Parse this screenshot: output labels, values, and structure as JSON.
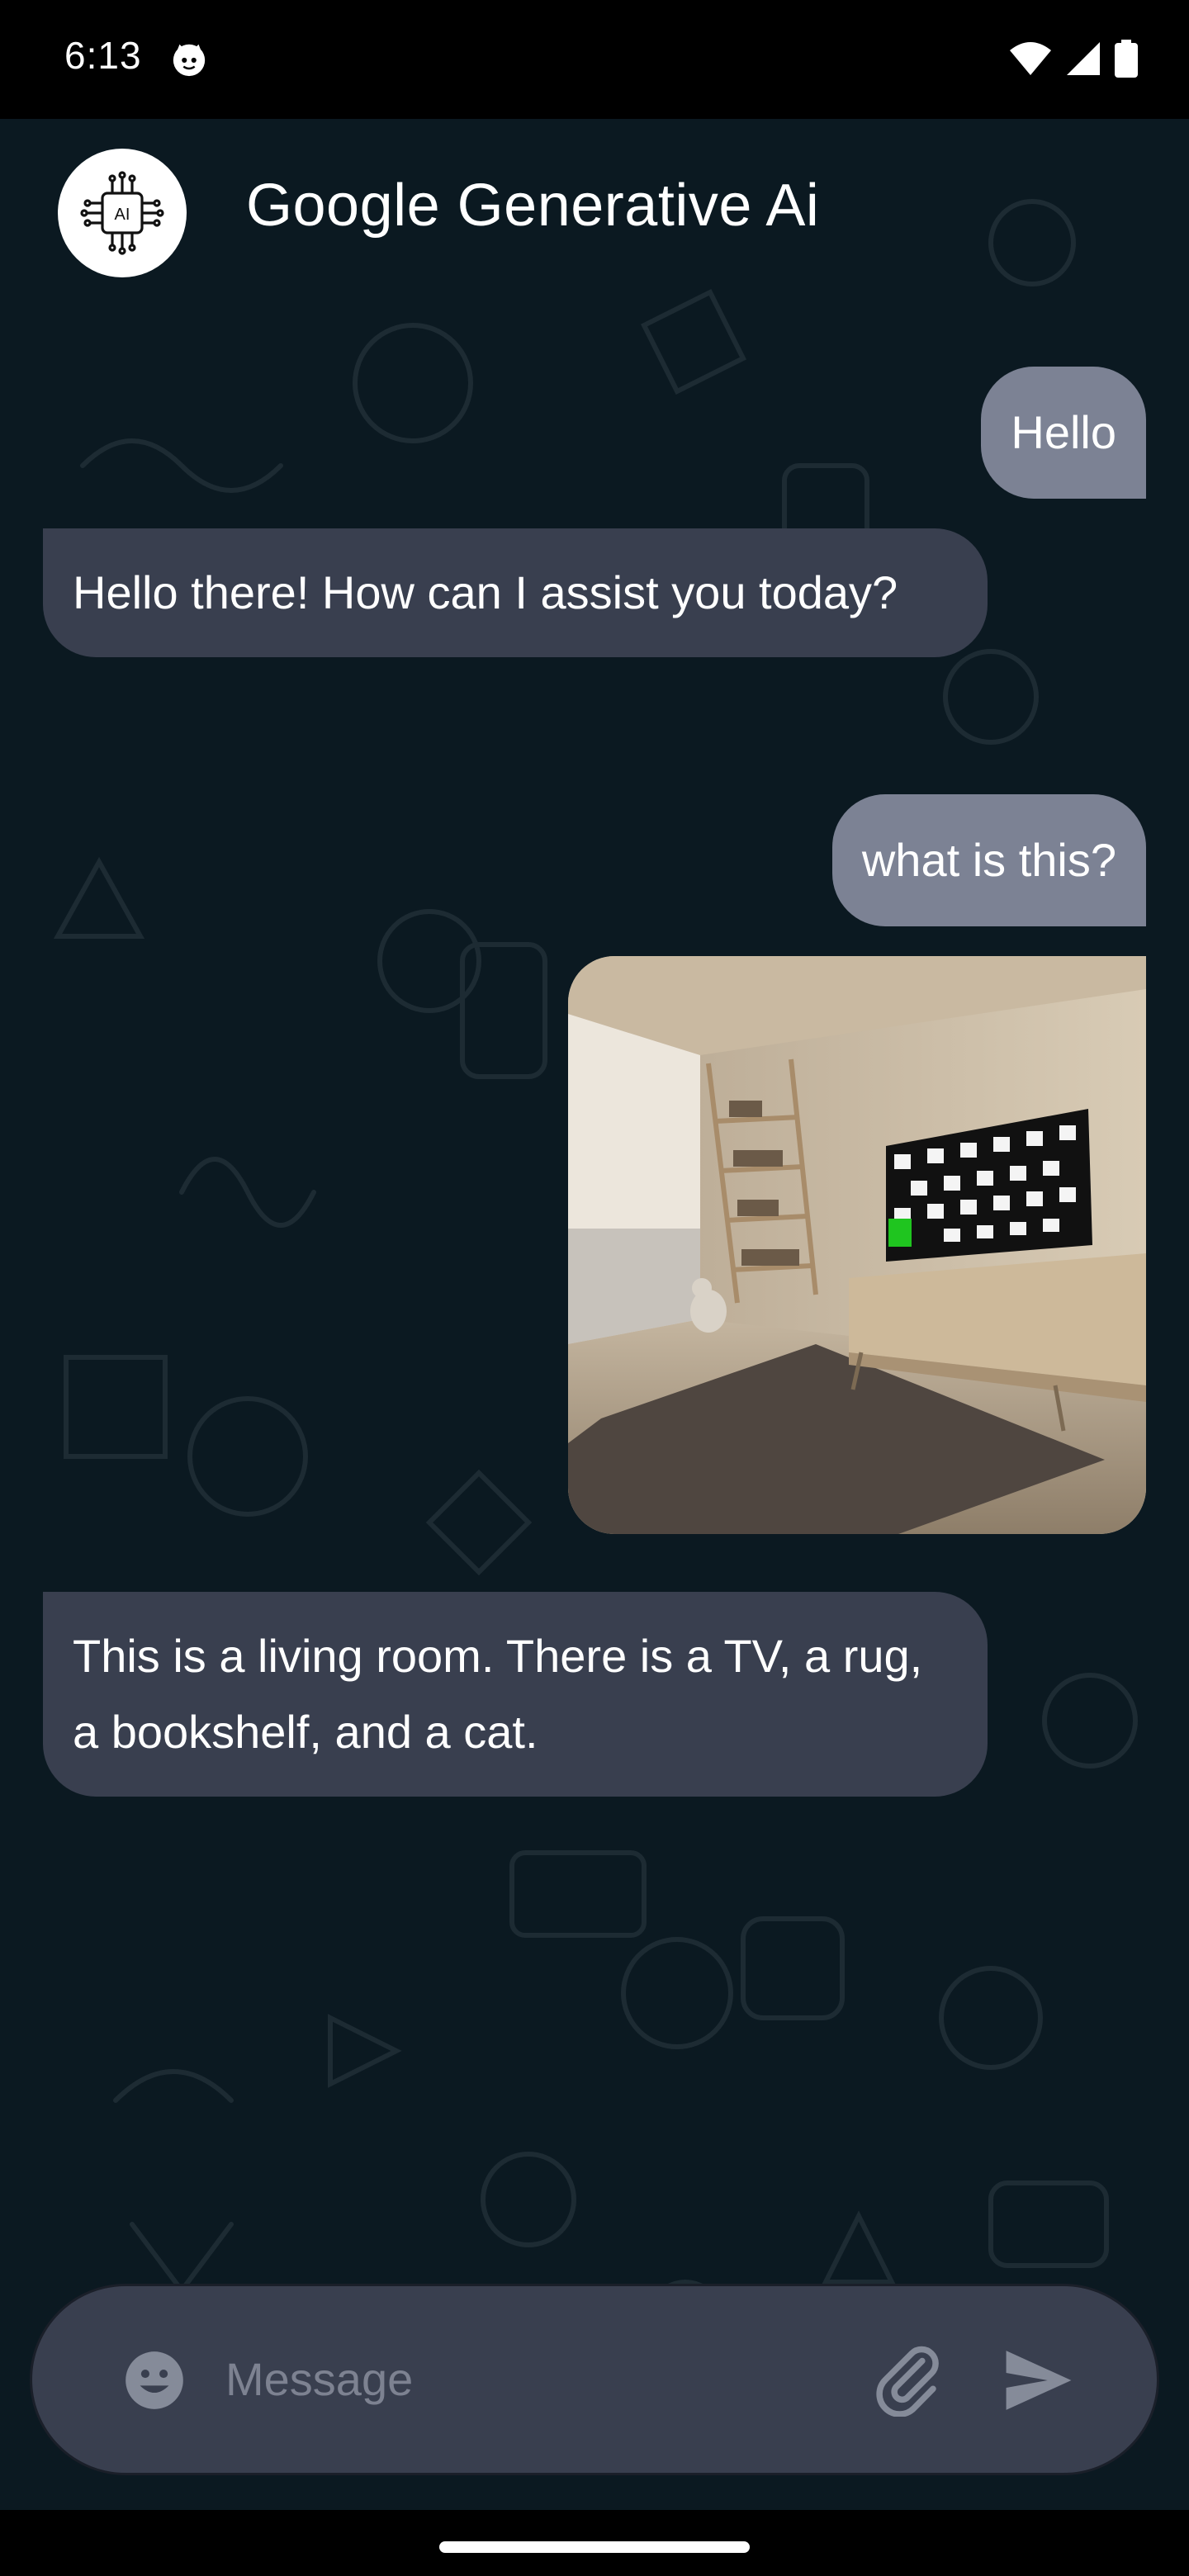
{
  "status_bar": {
    "time": "6:13"
  },
  "header": {
    "title": "Google Generative Ai",
    "avatar_text": "AI"
  },
  "messages": [
    {
      "role": "user",
      "text": "Hello"
    },
    {
      "role": "bot",
      "text": "Hello there! How can I assist you today?"
    },
    {
      "role": "user",
      "text": "what is this?"
    },
    {
      "role": "user",
      "type": "image",
      "icon": "living-room-photo"
    },
    {
      "role": "bot",
      "text": " This is a living room. There is a TV, a rug, a bookshelf, and a cat."
    }
  ],
  "input": {
    "placeholder": "Message"
  },
  "colors": {
    "background": "#0b1921",
    "user_bubble": "#7c8294",
    "bot_bubble": "#393f4f",
    "input_bar": "#393f4f",
    "placeholder": "#7d8291"
  }
}
